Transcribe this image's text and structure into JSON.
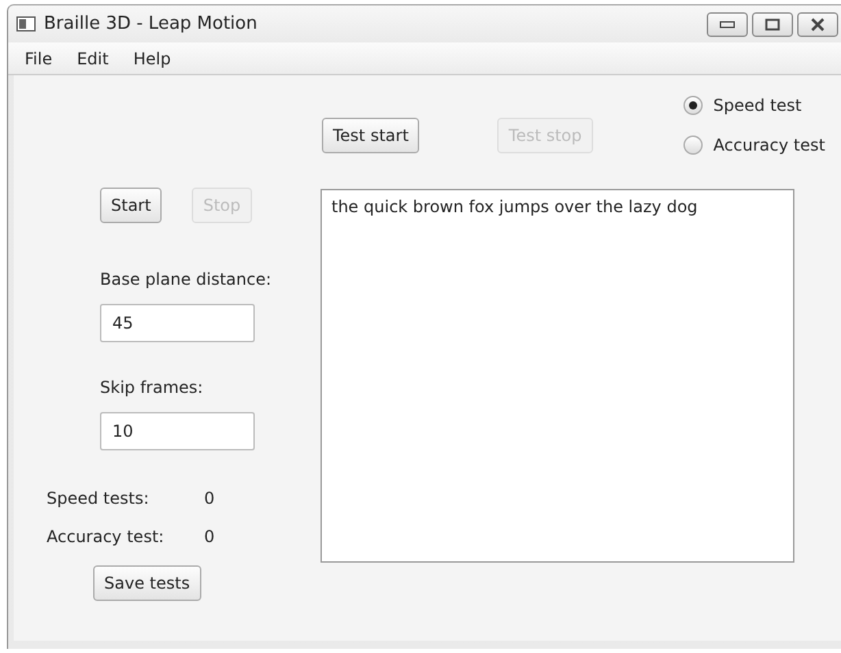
{
  "window": {
    "title": "Braille 3D - Leap Motion"
  },
  "menu": [
    "File",
    "Edit",
    "Help"
  ],
  "controls": {
    "start": {
      "label": "Start",
      "disabled": false
    },
    "stop": {
      "label": "Stop",
      "disabled": true
    },
    "fields": [
      {
        "label": "Base plane distance:",
        "value": "45"
      },
      {
        "label": "Skip frames:",
        "value": "10"
      }
    ],
    "stats": [
      {
        "label": "Speed tests:",
        "value": "0"
      },
      {
        "label": "Accuracy test:",
        "value": "0"
      }
    ],
    "save": {
      "label": "Save tests",
      "disabled": false
    }
  },
  "test": {
    "start": {
      "label": "Test start",
      "disabled": false
    },
    "stop": {
      "label": "Test stop",
      "disabled": true
    },
    "modes": [
      {
        "label": "Speed test",
        "selected": true
      },
      {
        "label": "Accuracy test",
        "selected": false
      }
    ],
    "text": "the quick brown fox jumps over the lazy dog"
  }
}
